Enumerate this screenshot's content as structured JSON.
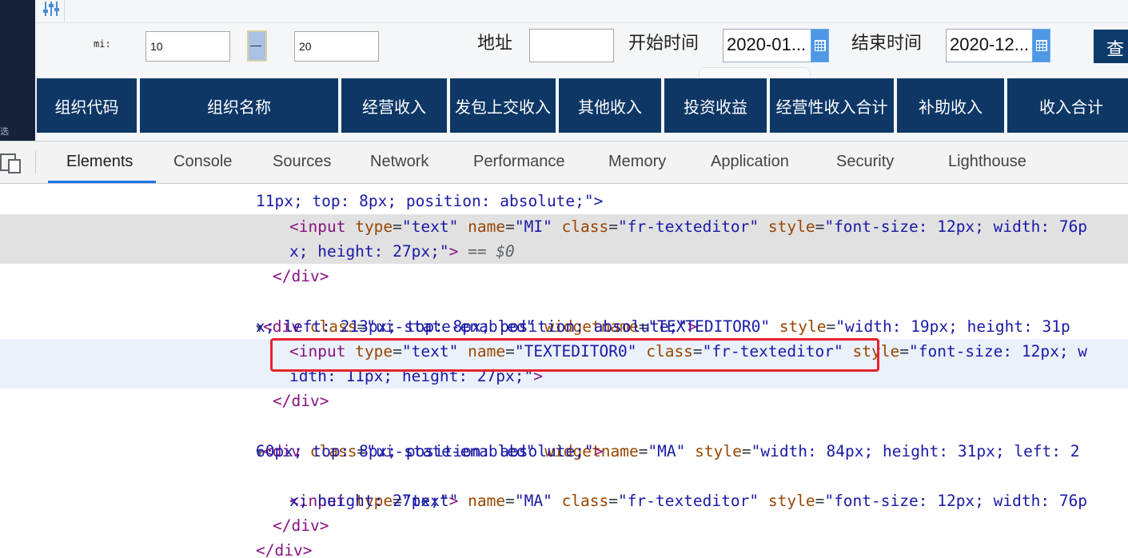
{
  "left_strip": {
    "fragment_char": "选"
  },
  "app": {
    "filter_labels": {
      "mi": "mi:",
      "range_sep": "—",
      "address": "地址",
      "start_time": "开始时间",
      "end_time": "结束时间",
      "query": "查"
    },
    "inputs": {
      "min_value": "10",
      "max_value": "20",
      "address_value": "",
      "start_date": "2020-01...",
      "end_date": "2020-12..."
    },
    "table_columns": [
      "组织代码",
      "组织名称",
      "经营收入",
      "发包上交收入",
      "其他收入",
      "投资收益",
      "经营性收入合计",
      "补助收入",
      "收入合计"
    ],
    "colors": {
      "header_bg": "#0e3766",
      "calendar_btn": "#4e98e6"
    }
  },
  "devtools": {
    "tabs": [
      "Elements",
      "Console",
      "Sources",
      "Network",
      "Performance",
      "Memory",
      "Application",
      "Security",
      "Lighthouse"
    ],
    "active_tab": "Elements",
    "dom_lines": {
      "l0": "11px; top: 8px; position: absolute;\">",
      "l1_tag": "<input",
      "l1_type_attr": "type",
      "l1_type_val": "\"text\"",
      "l1_name_attr": "name",
      "l1_name_val": "\"MI\"",
      "l1_class_attr": "class",
      "l1_class_val": "\"fr-texteditor\"",
      "l1_style_attr": "style",
      "l1_style_val": "\"font-size: 12px; width: 76p",
      "l2_val": "x; height: 27px;\"",
      "l2_close": ">",
      "l2_marker": "== $0",
      "l3": "</div>",
      "l4_tag": "<div",
      "l4_class_attr": "class",
      "l4_class_val": "\"ui-state-enabled\"",
      "l4_wn_attr": "widgetname",
      "l4_wn_val": "\"TEXTEDITOR0\"",
      "l4_style_attr": "style",
      "l4_style_val": "\"width: 19px; height: 31p",
      "l5_val": "x; left: 213px; top: 8px; position: absolute;\"",
      "l5_close": ">",
      "l6_tag": "<input",
      "l6_type_attr": "type",
      "l6_type_val": "\"text\"",
      "l6_name_attr": "name",
      "l6_name_val": "\"TEXTEDITOR0\"",
      "l6_class_attr": "class",
      "l6_class_val": "\"fr-texteditor\"",
      "l6_style_attr": "style",
      "l6_style_val": "\"font-size: 12px; w",
      "l7_val": "idth: 11px; height: 27px;\"",
      "l7_close": ">",
      "l8": "</div>",
      "l9_tag": "<div",
      "l9_class_attr": "class",
      "l9_class_val": "\"ui-state-enabled\"",
      "l9_wn_attr": "widgetname",
      "l9_wn_val": "\"MA\"",
      "l9_style_attr": "style",
      "l9_style_val": "\"width: 84px; height: 31px; left: 2",
      "l10_val": "60px; top: 8px; position: absolute;\"",
      "l10_close": ">",
      "l11_tag": "<input",
      "l11_type_attr": "type",
      "l11_type_val": "\"text\"",
      "l11_name_attr": "name",
      "l11_name_val": "\"MA\"",
      "l11_class_attr": "class",
      "l11_class_val": "\"fr-texteditor\"",
      "l11_style_attr": "style",
      "l11_style_val": "\"font-size: 12px; width: 76p",
      "l12_val": "x; height: 27px;\"",
      "l12_close": ">",
      "l13": "</div>",
      "l14": "</div>"
    }
  }
}
